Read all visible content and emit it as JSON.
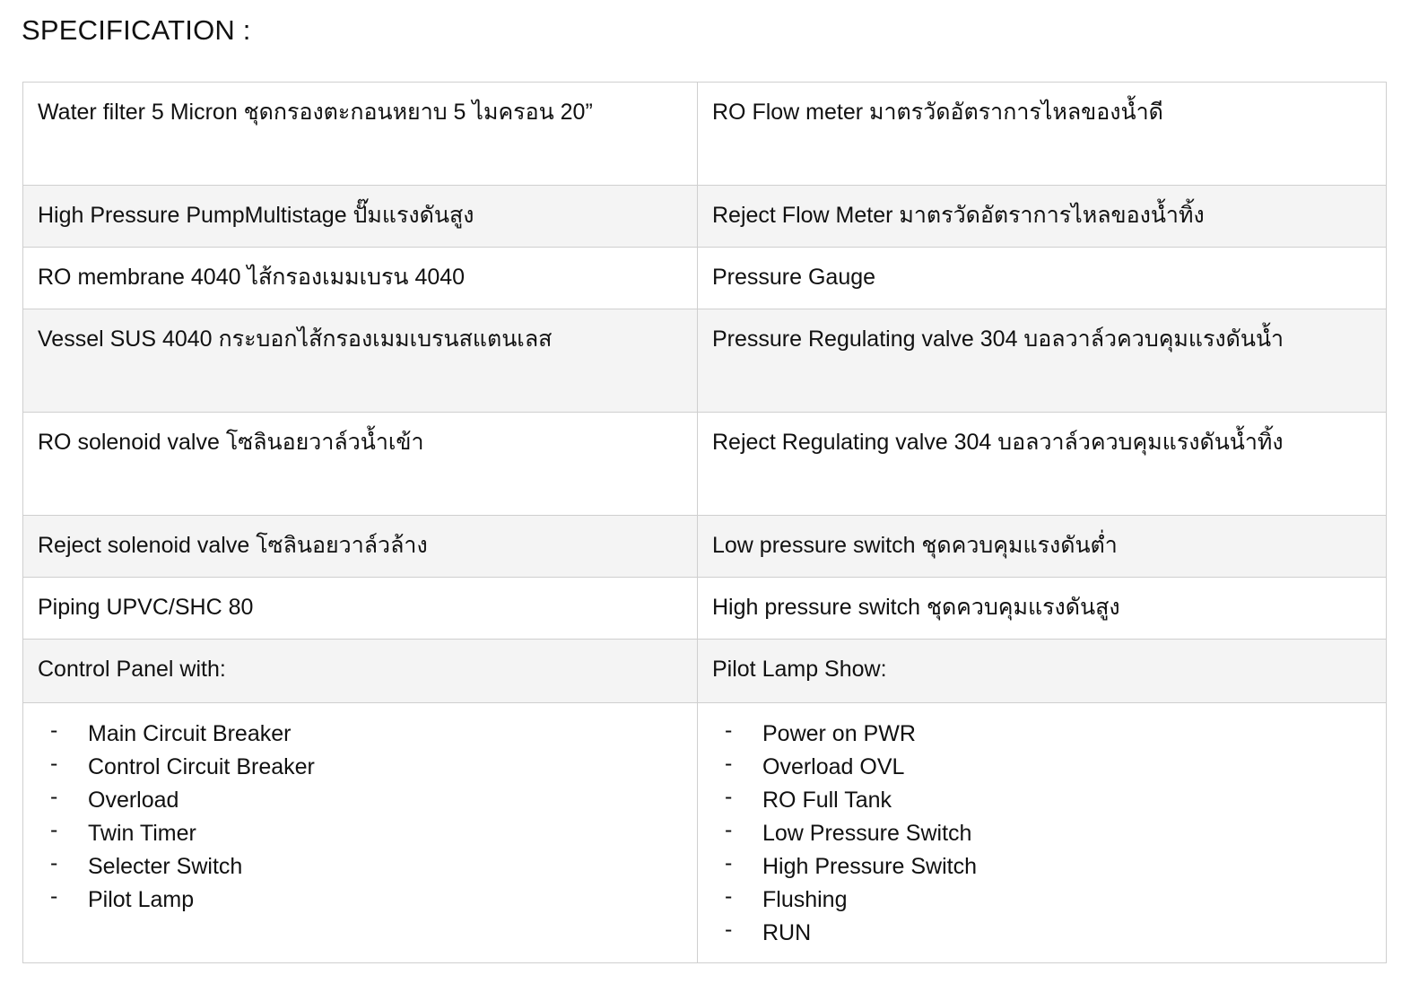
{
  "document": {
    "title": "SPECIFICATION :"
  },
  "spec_table": {
    "rows": [
      {
        "shaded": false,
        "left": {
          "type": "text",
          "text": "Water filter 5 Micron ชุดกรองตะกอนหยาบ 5 ไมครอน 20”"
        },
        "right": {
          "type": "text",
          "text": "RO Flow meter มาตรวัดอัตราการไหลของน้ำดี"
        }
      },
      {
        "shaded": true,
        "left": {
          "type": "text",
          "text": "High Pressure PumpMultistage ปั๊มแรงดันสูง"
        },
        "right": {
          "type": "text",
          "text": "Reject Flow Meter มาตรวัดอัตราการไหลของน้ำทิ้ง"
        }
      },
      {
        "shaded": false,
        "left": {
          "type": "text",
          "text": "RO membrane 4040 ไส้กรองเมมเบรน 4040"
        },
        "right": {
          "type": "text",
          "text": "Pressure Gauge"
        }
      },
      {
        "shaded": true,
        "left": {
          "type": "text",
          "text": "Vessel SUS 4040 กระบอกไส้กรองเมมเบรนสแตนเลส"
        },
        "right": {
          "type": "text",
          "text": "Pressure Regulating valve 304 บอลวาล์วควบคุมแรงดันน้ำ"
        }
      },
      {
        "shaded": false,
        "left": {
          "type": "text",
          "text": "RO solenoid valve โซลินอยวาล์วน้ำเข้า"
        },
        "right": {
          "type": "text",
          "text": "Reject Regulating valve 304 บอลวาล์วควบคุมแรงดันน้ำทิ้ง"
        }
      },
      {
        "shaded": true,
        "left": {
          "type": "text",
          "text": "Reject solenoid valve โซลินอยวาล์วล้าง"
        },
        "right": {
          "type": "text",
          "text": "Low pressure switch ชุดควบคุมแรงดันต่ำ"
        }
      },
      {
        "shaded": false,
        "left": {
          "type": "text",
          "text": "Piping UPVC/SHC 80"
        },
        "right": {
          "type": "text",
          "text": "High pressure switch ชุดควบคุมแรงดันสูง"
        }
      },
      {
        "shaded": true,
        "left": {
          "type": "text",
          "text": "Control Panel with:"
        },
        "right": {
          "type": "text",
          "text": "Pilot Lamp Show:"
        }
      },
      {
        "shaded": false,
        "left": {
          "type": "list",
          "bullet": "-",
          "items": [
            "Main Circuit Breaker",
            "Control Circuit Breaker",
            "Overload",
            "Twin Timer",
            "Selecter Switch",
            "Pilot Lamp"
          ]
        },
        "right": {
          "type": "list",
          "bullet": "-",
          "items": [
            "Power on PWR",
            "Overload OVL",
            "RO Full Tank",
            "Low Pressure Switch",
            "High Pressure Switch",
            "Flushing",
            "RUN"
          ]
        }
      }
    ]
  },
  "colors": {
    "text": "#111111",
    "border": "#cfcfcf",
    "row_shaded_background": "#f4f4f4",
    "row_plain_background": "#ffffff",
    "page_background": "#ffffff"
  }
}
